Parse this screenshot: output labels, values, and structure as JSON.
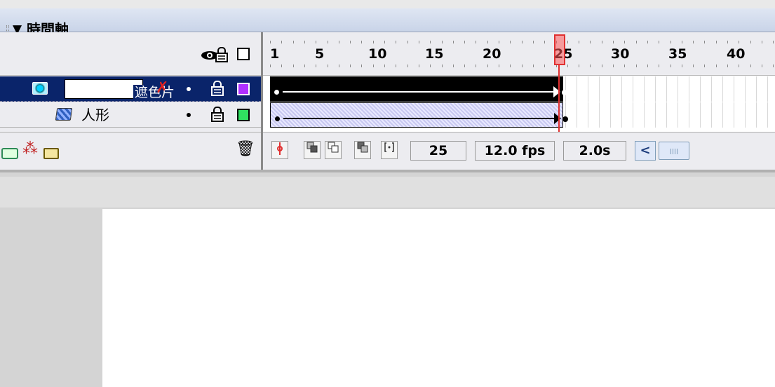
{
  "panel": {
    "title": "時間軸",
    "collapse_arrow": "▼"
  },
  "layers": {
    "header_icons": [
      "eye-icon",
      "lock-icon",
      "outline-icon"
    ],
    "items": [
      {
        "name": "遮色片",
        "type": "mask",
        "editing": true,
        "pencil_icon": "✗",
        "outline_color": "#b030ff",
        "selected": true
      },
      {
        "name": "人形",
        "type": "masked",
        "outline_color": "#30e060",
        "selected": false
      }
    ],
    "footer_icons": [
      "add-layer-icon",
      "add-motion-guide-icon",
      "add-folder-icon",
      "trash-icon"
    ]
  },
  "ruler": {
    "labels": [
      "1",
      "5",
      "10",
      "15",
      "20",
      "25",
      "30",
      "35",
      "40"
    ],
    "current_frame": 25
  },
  "status": {
    "current_frame": "25",
    "fps": "12.0 fps",
    "elapsed_time": "2.0s",
    "scroll_left": "<"
  },
  "colors": {
    "selection": "#0a246a",
    "playhead": "#e03030",
    "mask_outline": "#b030ff",
    "shape_outline": "#30e060"
  },
  "icons": {
    "lock": "🔒",
    "trash": "🗑",
    "guide": "⁂"
  }
}
